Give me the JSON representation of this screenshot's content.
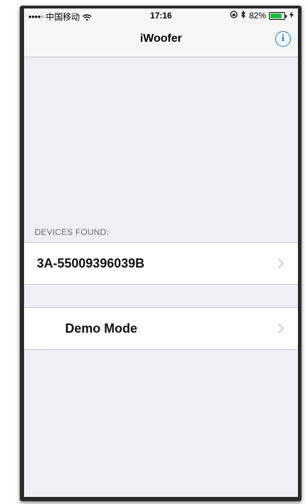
{
  "status_bar": {
    "carrier": "中国移动",
    "signal_dots": "●●●●○",
    "time": "17:16",
    "battery_percent": "82%",
    "battery_level": 0.82,
    "battery_color": "#1fbf3b"
  },
  "nav": {
    "title": "iWoofer",
    "info_icon_glyph": "i",
    "accent_color": "#007aff"
  },
  "devices_section": {
    "header": "DEVICES FOUND:",
    "items": [
      {
        "label": "3A-55009396039B"
      }
    ]
  },
  "demo_section": {
    "label": "Demo Mode"
  }
}
